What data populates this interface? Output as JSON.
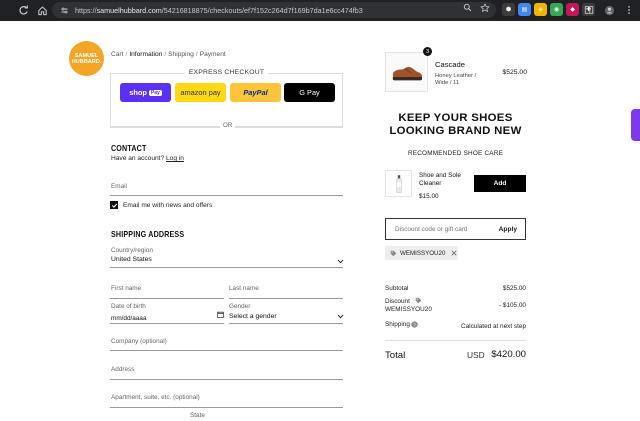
{
  "browser": {
    "url_prefix": "https://",
    "url_domain": "samuelhubbard.com",
    "url_path": "/54216818875/checkouts/ef7f152c264d7f169b7da1e6cc474fb3"
  },
  "logo": {
    "line1": "SAMUEL",
    "line2": "HUBBARD.",
    "color": "#f5a524"
  },
  "breadcrumb": [
    "Cart",
    "Information",
    "Shipping",
    "Payment"
  ],
  "express": {
    "title": "EXPRESS CHECKOUT",
    "shop_pay": "shop",
    "shop_pay_pill": "Pay",
    "amazon_pay": "amazon pay",
    "paypal": "PayPal",
    "gpay": "G Pay"
  },
  "or_text": "OR",
  "contact": {
    "title": "CONTACT",
    "have_account": "Have an account?",
    "login": "Log in",
    "email_label": "Email",
    "email_offers": "Email me with news and offers"
  },
  "shipping": {
    "title": "SHIPPING ADDRESS",
    "country_label": "Country/region",
    "country_value": "United States",
    "first_name": "First name",
    "last_name": "Last name",
    "dob_label": "Date of birth",
    "dob_value": "mm/dd/aaaa",
    "gender_label": "Gender",
    "gender_value": "Select a gender",
    "company": "Company (optional)",
    "address": "Address",
    "apartment": "Apartment, suite, etc. (optional)",
    "state": "State"
  },
  "cart_item": {
    "qty": "3",
    "name": "Cascade",
    "variant": "Honey Leather / Wide / 11",
    "price": "$525.00"
  },
  "promo": {
    "heading": "KEEP YOUR SHOES LOOKING BRAND NEW",
    "rec_title": "RECOMMENDED SHOE CARE",
    "rec_name": "Shoe and Sole Cleaner",
    "rec_price": "$15.00",
    "add_label": "Add"
  },
  "discount": {
    "placeholder": "Discount code or gift card",
    "apply": "Apply",
    "code": "WEMISSYOU20"
  },
  "summary": {
    "subtotal_label": "Subtotal",
    "subtotal_value": "$525.00",
    "discount_label": "Discount",
    "discount_code": "WEMISSYOU20",
    "discount_value": "- $105.00",
    "shipping_label": "Shipping",
    "shipping_value": "Calculated at next step",
    "total_label": "Total",
    "total_currency": "USD",
    "total_value": "$420.00"
  },
  "colors": {
    "shop_pay": "#5a31f4",
    "amazon": "#ffd814",
    "paypal": "#ffc439",
    "accent": "#f5a524"
  }
}
